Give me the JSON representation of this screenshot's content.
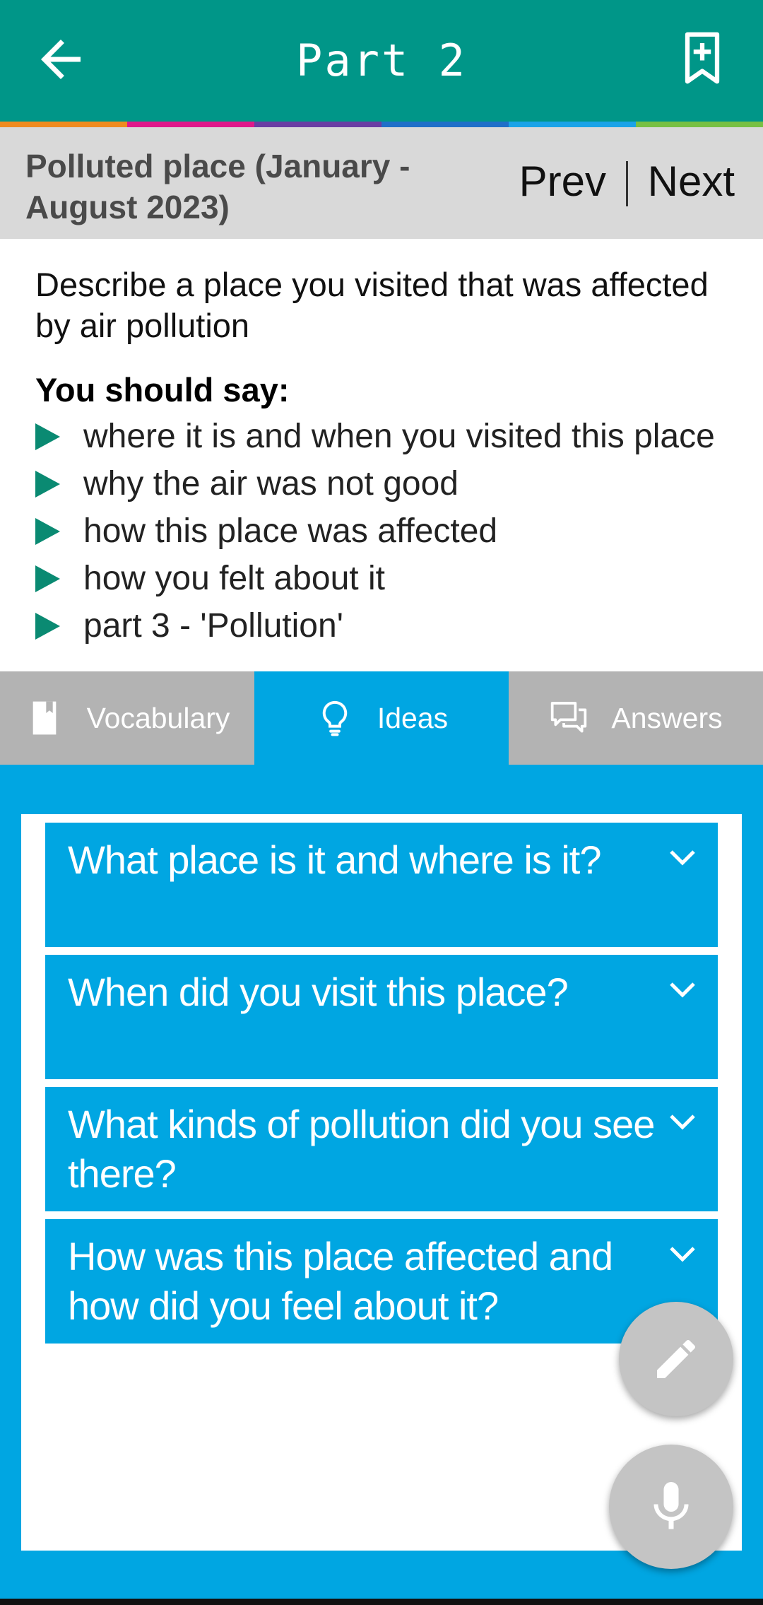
{
  "appbar": {
    "title": "Part 2"
  },
  "stripe_colors": [
    "#ef8b1f",
    "#e0188a",
    "#6a3da3",
    "#1f6fc8",
    "#1aa3e8",
    "#78c043"
  ],
  "topic": {
    "title": "Polluted place (January - August 2023)",
    "prev_label": "Prev",
    "next_label": "Next"
  },
  "prompt": {
    "description": "Describe a place you visited that was affected by air pollution",
    "should_say": "You should say:",
    "points": [
      "where it is and when you visited this place",
      "why the air was not good",
      "how this place was affected",
      "how you felt about it",
      "part 3 - 'Pollution'"
    ]
  },
  "tabs": [
    {
      "label": "Vocabulary",
      "icon": "book-icon",
      "active": false
    },
    {
      "label": "Ideas",
      "icon": "lightbulb-icon",
      "active": true
    },
    {
      "label": "Answers",
      "icon": "chat-icon",
      "active": false
    }
  ],
  "ideas": [
    "What place is it and where is it?",
    "When did you visit this place?",
    "What kinds of pollution did you see there?",
    "How was this place affected and how did you feel about it?"
  ],
  "colors": {
    "appbar": "#009688",
    "accent": "#00a6e2",
    "bullet": "#0a8a72"
  }
}
